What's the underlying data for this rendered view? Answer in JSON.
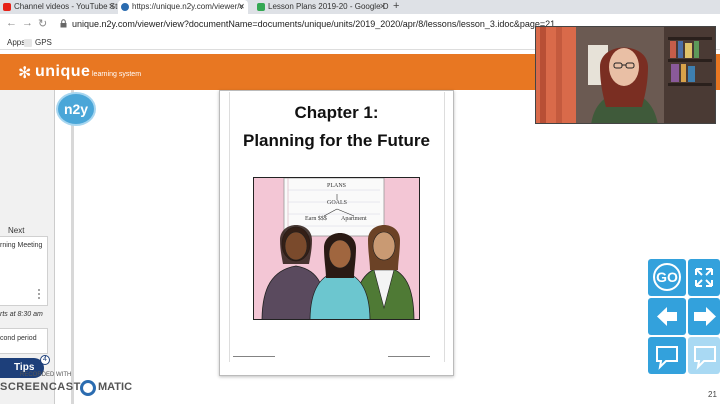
{
  "browser": {
    "tabs": [
      {
        "title": "Channel videos - YouTube Studio",
        "fav_color": "#e62117"
      },
      {
        "title": "https://unique.n2y.com/viewer/v",
        "fav_color": "#2b6cb0"
      },
      {
        "title": "Lesson Plans 2019-20 - Google D",
        "fav_color": "#34a853"
      }
    ],
    "new_tab": "+",
    "url": "unique.n2y.com/viewer/view?documentName=documents/unique/units/2019_2020/apr/8/lessons/lesson_3.idoc&page=21",
    "bookmarks": [
      "Apps",
      "GPS"
    ]
  },
  "app": {
    "logo_glyph": "✻",
    "logo_text": "unique",
    "logo_sub": "learning system"
  },
  "sidebar": {
    "badge": "n2y",
    "next_label": "Next",
    "card1_title": "rning Meeting",
    "meta": "rts at 8:30 am",
    "card2_title": "cond period",
    "tips_label": "Tips",
    "tips_count": "4"
  },
  "watermark": {
    "recorded": "RECORDED WITH",
    "screencast": "SCREENCAST",
    "matic": "MATIC"
  },
  "document": {
    "chapter": "Chapter 1:",
    "subtitle": "Planning for the Future",
    "notepad": {
      "line1": "PLANS",
      "line2": "GOALS",
      "line3": "Earn $$$",
      "line4": "Apartment"
    }
  },
  "controls": {
    "go_label": "GO",
    "page_number": "21"
  },
  "colors": {
    "header": "#e87722",
    "control_blue": "#33a1dc",
    "control_light": "#a9d9f3",
    "illustration_bg": "#f3c6d5"
  }
}
